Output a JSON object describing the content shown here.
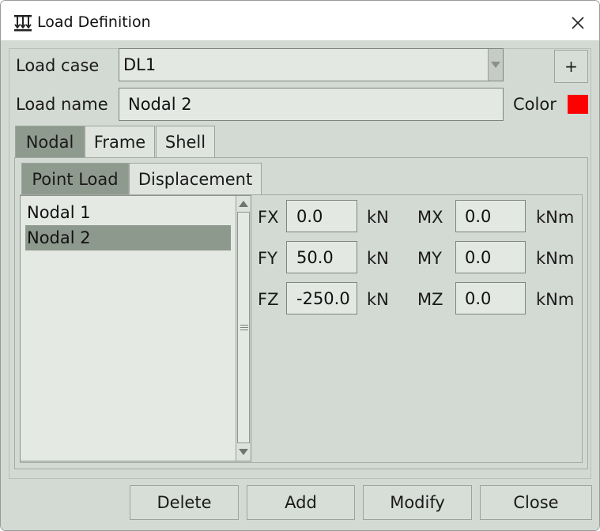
{
  "window": {
    "title": "Load Definition",
    "icon": "load-arrows-icon",
    "close_icon": "close-icon"
  },
  "form": {
    "load_case_label": "Load case",
    "load_case_value": "DL1",
    "add_case_label": "+",
    "load_name_label": "Load name",
    "load_name_value": "Nodal 2",
    "color_label": "Color",
    "color_value": "#ff0000"
  },
  "tabs": [
    {
      "label": "Nodal",
      "active": true
    },
    {
      "label": "Frame",
      "active": false
    },
    {
      "label": "Shell",
      "active": false
    }
  ],
  "subtabs": [
    {
      "label": "Point Load",
      "active": true
    },
    {
      "label": "Displacement",
      "active": false
    }
  ],
  "nodes": [
    {
      "label": "Nodal 1",
      "selected": false
    },
    {
      "label": "Nodal 2",
      "selected": true
    }
  ],
  "forces": [
    {
      "label": "FX",
      "value": "0.0",
      "unit": "kN"
    },
    {
      "label": "FY",
      "value": "50.0",
      "unit": "kN"
    },
    {
      "label": "FZ",
      "value": "-250.0",
      "unit": "kN"
    }
  ],
  "moments": [
    {
      "label": "MX",
      "value": "0.0",
      "unit": "kNm"
    },
    {
      "label": "MY",
      "value": "0.0",
      "unit": "kNm"
    },
    {
      "label": "MZ",
      "value": "0.0",
      "unit": "kNm"
    }
  ],
  "buttons": {
    "delete": "Delete",
    "add": "Add",
    "modify": "Modify",
    "close": "Close"
  },
  "colors": {
    "background": "#d3d9d3",
    "field": "#e3e8e3",
    "active_tab": "#8f9a8f",
    "selection": "#8e998e"
  }
}
